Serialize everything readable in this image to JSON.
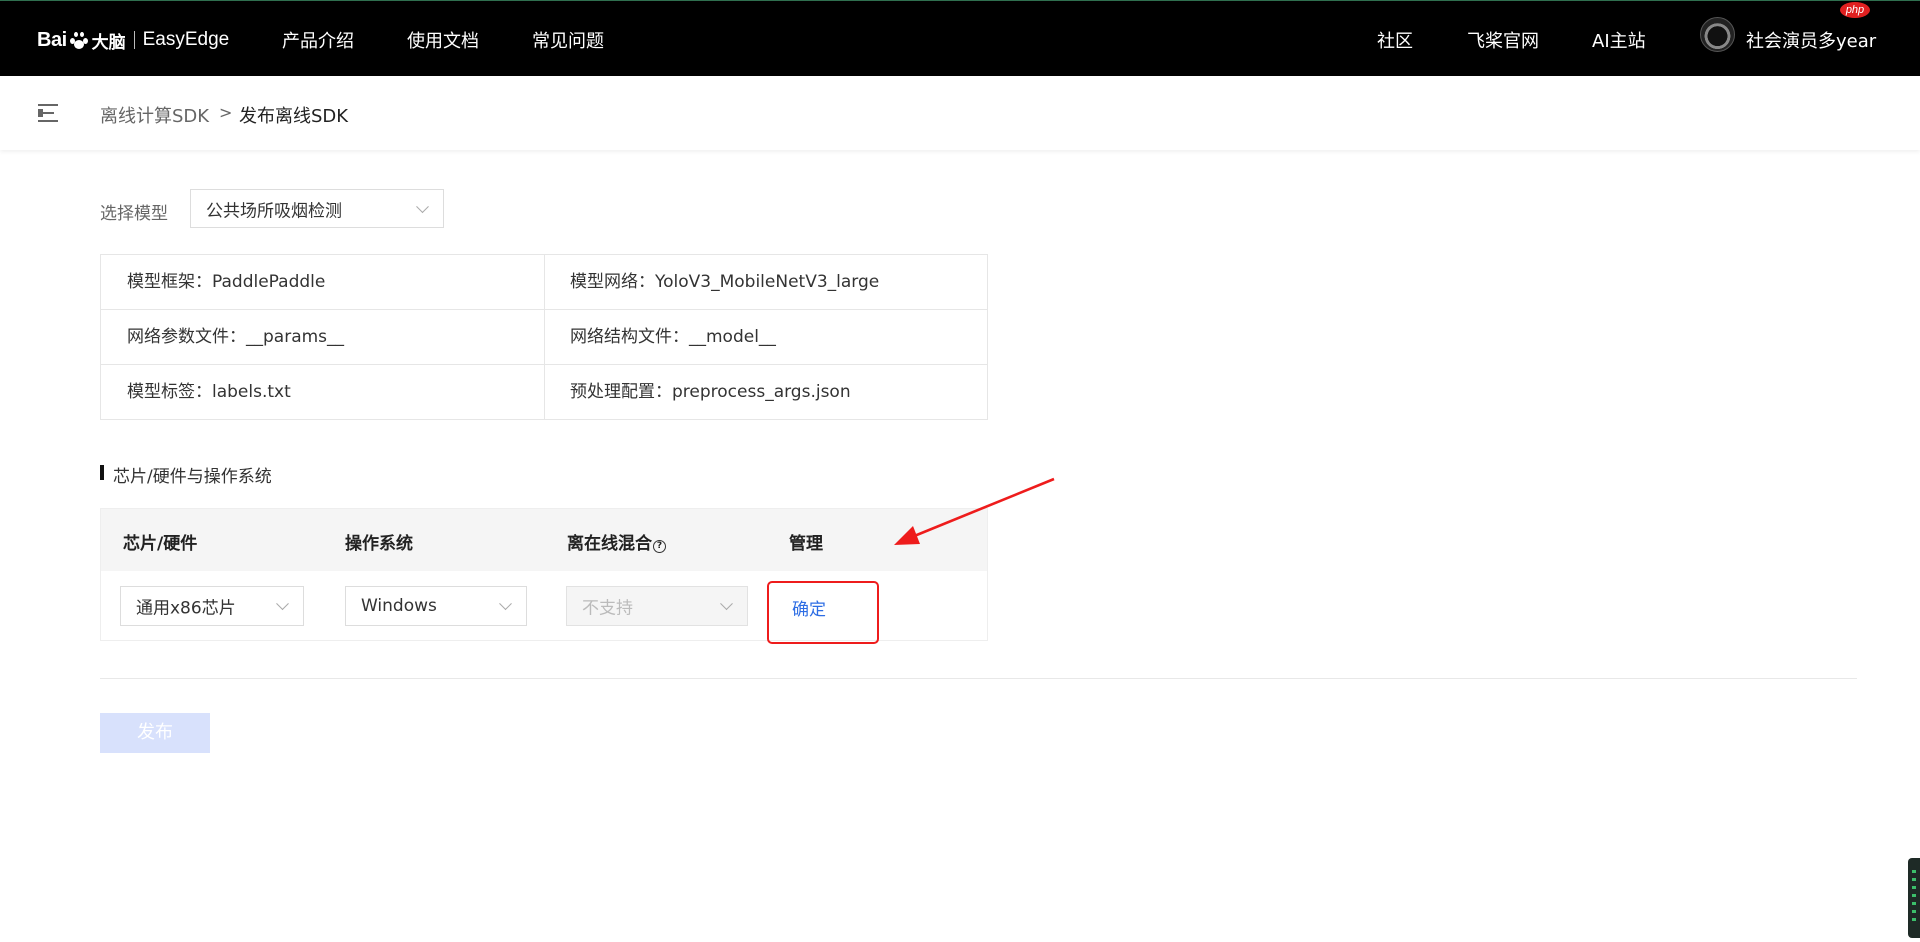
{
  "header": {
    "logo_text_bai": "Bai",
    "logo_text_brand": "大脑",
    "logo_text_product": "EasyEdge",
    "nav_left": [
      "产品介绍",
      "使用文档",
      "常见问题"
    ],
    "nav_right": [
      "社区",
      "飞桨官网",
      "AI主站"
    ],
    "user_name": "社会演员多year",
    "badge": "php"
  },
  "breadcrumb": {
    "parent": "离线计算SDK",
    "separator": ">",
    "current": "发布离线SDK"
  },
  "model_select": {
    "label": "选择模型",
    "value": "公共场所吸烟检测"
  },
  "model_info": [
    [
      "模型框架：PaddlePaddle",
      "模型网络：YoloV3_MobileNetV3_large"
    ],
    [
      "网络参数文件：__params__",
      "网络结构文件：__model__"
    ],
    [
      "模型标签：labels.txt",
      "预处理配置：preprocess_args.json"
    ]
  ],
  "section": {
    "title": "芯片/硬件与操作系统"
  },
  "table": {
    "headers": [
      "芯片/硬件",
      "操作系统",
      "离在线混合",
      "管理"
    ],
    "help_icon": "?",
    "row": {
      "chip": "通用x86芯片",
      "os": "Windows",
      "hybrid": "不支持",
      "action": "确定"
    }
  },
  "publish_button": "发布",
  "colors": {
    "topbar": "#000000",
    "link": "#2d6de4",
    "highlight": "#ee1c1c",
    "publish_disabled": "#d8e1fc"
  }
}
